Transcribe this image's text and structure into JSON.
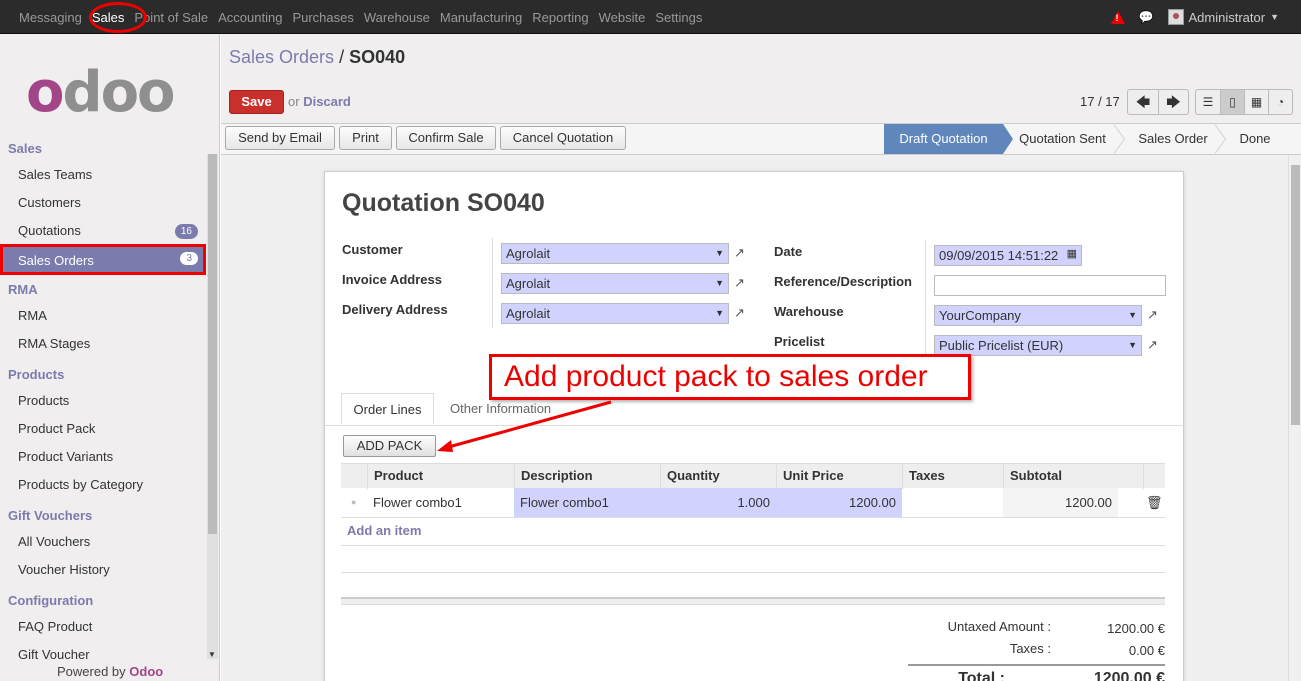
{
  "topbar": {
    "menu": [
      "Messaging",
      "Sales",
      "Point of Sale",
      "Accounting",
      "Purchases",
      "Warehouse",
      "Manufacturing",
      "Reporting",
      "Website",
      "Settings"
    ],
    "active": "Sales",
    "user": "Administrator",
    "alert_color": "#e00000"
  },
  "sidebar": {
    "logo": "odoo",
    "sections": [
      {
        "title": "Sales",
        "items": [
          "Sales Teams",
          "Customers",
          "Quotations",
          "Sales Orders"
        ]
      },
      {
        "title": "RMA",
        "items": [
          "RMA",
          "RMA Stages"
        ]
      },
      {
        "title": "Products",
        "items": [
          "Products",
          "Product Pack",
          "Product Variants",
          "Products by Category"
        ]
      },
      {
        "title": "Gift Vouchers",
        "items": [
          "All Vouchers",
          "Voucher History"
        ]
      },
      {
        "title": "Configuration",
        "items": [
          "FAQ Product",
          "Gift Voucher"
        ]
      }
    ],
    "quotations_count": "16",
    "sales_orders_count": "3",
    "powered_prefix": "Powered by",
    "powered_brand": "Odoo"
  },
  "control_panel": {
    "breadcrumb_parent": "Sales Orders",
    "breadcrumb_sep": "/",
    "breadcrumb_current": "SO040",
    "save_label": "Save",
    "or_label": "or",
    "discard_label": "Discard",
    "pager": "17 / 17"
  },
  "statusbar": {
    "buttons": [
      "Send by Email",
      "Print",
      "Confirm Sale",
      "Cancel Quotation"
    ],
    "stages": [
      "Draft Quotation",
      "Quotation Sent",
      "Sales Order",
      "Done"
    ],
    "current_stage": "Draft Quotation"
  },
  "form": {
    "title": "Quotation SO040",
    "left_labels": [
      "Customer",
      "Invoice Address",
      "Delivery Address"
    ],
    "left_values": [
      "Agrolait",
      "Agrolait",
      "Agrolait"
    ],
    "right_labels": [
      "Date",
      "Reference/Description",
      "Warehouse",
      "Pricelist"
    ],
    "date": "09/09/2015 14:51:22",
    "reference": "",
    "warehouse": "YourCompany",
    "pricelist": "Public Pricelist (EUR)",
    "callout": "Add product pack to sales order",
    "tabs": [
      "Order Lines",
      "Other Information"
    ],
    "add_pack_label": "ADD PACK",
    "columns": [
      "Product",
      "Description",
      "Quantity",
      "Unit Price",
      "Taxes",
      "Subtotal"
    ],
    "rows": [
      {
        "product": "Flower combo1",
        "description": "Flower combo1",
        "quantity": "1.000",
        "unit_price": "1200.00",
        "taxes": "",
        "subtotal": "1200.00"
      }
    ],
    "add_item_label": "Add an item",
    "untaxed_label": "Untaxed Amount :",
    "untaxed_value": "1200.00 €",
    "taxes_label": "Taxes :",
    "taxes_value": "0.00 €",
    "total_label": "Total :",
    "total_value": "1200.00 €"
  }
}
